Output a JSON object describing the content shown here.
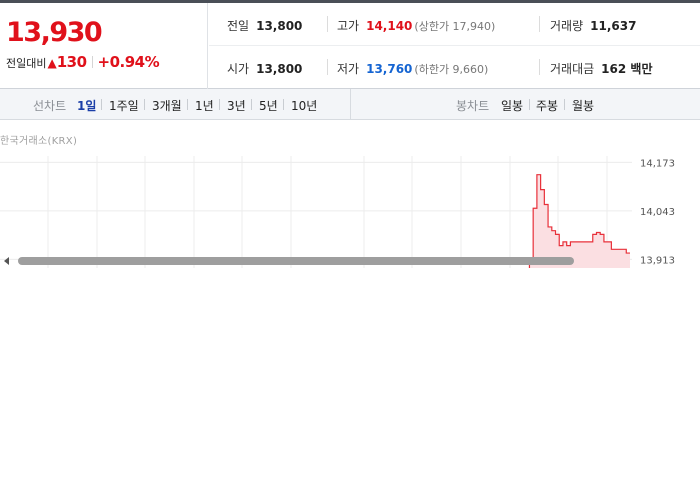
{
  "summary": {
    "price": "13,930",
    "change_label": "전일대비",
    "change_arrow": "▲",
    "change_value": "130",
    "change_pct": "+0.94%"
  },
  "quotes": {
    "prev_close": {
      "label": "전일",
      "value": "13,800"
    },
    "high": {
      "label": "고가",
      "value": "14,140",
      "sub": "(상한가 17,940)"
    },
    "volume": {
      "label": "거래량",
      "value": "11,637"
    },
    "open": {
      "label": "시가",
      "value": "13,800"
    },
    "low": {
      "label": "저가",
      "value": "13,760",
      "sub": "(하한가 9,660)"
    },
    "trade_amount": {
      "label": "거래대금",
      "value": "162 백만"
    }
  },
  "period_bar": {
    "line_label": "선차트",
    "line_tabs": [
      "1일",
      "1주일",
      "3개월",
      "1년",
      "3년",
      "5년",
      "10년"
    ],
    "active_line_tab": "1일",
    "candle_label": "봉차트",
    "candle_tabs": [
      "일봉",
      "주봉",
      "월봉"
    ]
  },
  "chart": {
    "exchange": "한국거래소(KRX)",
    "colors": {
      "line": "#e8303a",
      "fill": "#fbdfe2",
      "grid": "#ececec"
    }
  },
  "chart_data": {
    "type": "area",
    "title": "",
    "xlabel": "",
    "ylabel": "",
    "y_ticks": [
      "14,173",
      "14,043",
      "13,913"
    ],
    "ylim": [
      13890,
      14190
    ],
    "grid": true,
    "x": [
      0,
      1,
      2,
      3,
      4,
      5,
      6,
      7,
      8,
      9,
      10,
      11,
      12,
      13,
      14,
      15,
      16,
      17,
      18,
      19,
      20,
      21,
      22,
      23,
      24,
      25,
      26,
      27,
      28,
      29
    ],
    "series": [
      {
        "values": [
          13800,
          13880,
          13910,
          14050,
          14140,
          14100,
          14060,
          14000,
          13990,
          13980,
          13950,
          13960,
          13950,
          13960,
          13960,
          13960,
          13960,
          13960,
          13960,
          13980,
          13985,
          13980,
          13960,
          13960,
          13940,
          13940,
          13940,
          13940,
          13930,
          13930
        ]
      }
    ]
  },
  "scrollbar": {
    "position": 0.8
  }
}
